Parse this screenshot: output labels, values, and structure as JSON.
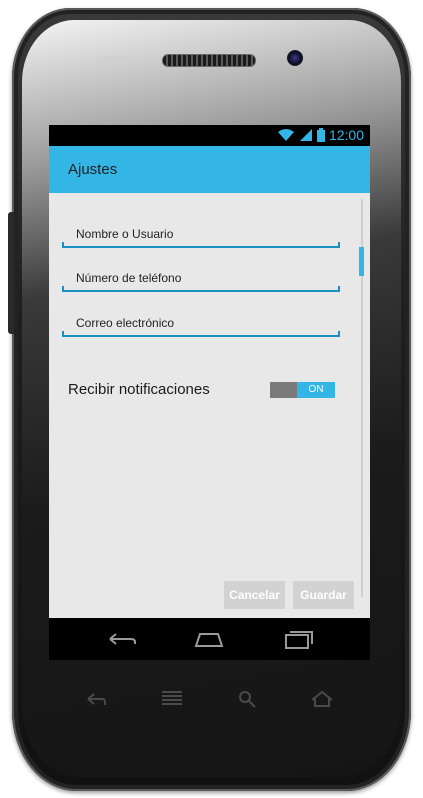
{
  "status_bar": {
    "time": "12:00"
  },
  "action_bar": {
    "title": "Ajustes"
  },
  "form": {
    "fields": [
      {
        "placeholder": "Nombre o Usuario"
      },
      {
        "placeholder": "Número de teléfono"
      },
      {
        "placeholder": "Correo electrónico"
      }
    ],
    "notifications": {
      "label": "Recibir notificaciones",
      "toggle_state": "ON"
    }
  },
  "buttons": {
    "cancel": "Cancelar",
    "save": "Guardar"
  },
  "colors": {
    "accent": "#33b5e5",
    "field_line": "#1b8ec2",
    "background": "#e8e8e8"
  }
}
